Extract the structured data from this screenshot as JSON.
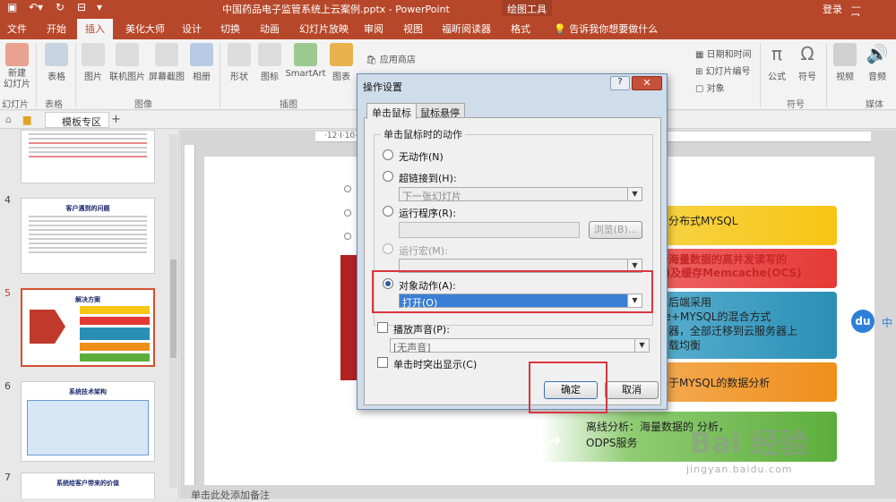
{
  "titlebar": {
    "title": "中国药品电子监管系统上云案例.pptx  -  PowerPoint",
    "context_tab": "绘图工具",
    "login": "登录",
    "window_controls": "— ❐ ✕"
  },
  "tabs": [
    "文件",
    "开始",
    "插入",
    "美化大师",
    "设计",
    "切换",
    "动画",
    "幻灯片放映",
    "审阅",
    "视图",
    "福昕阅读器",
    "格式"
  ],
  "tell_me": "告诉我你想要做什么",
  "ribbon": {
    "new_slide": "新建\n幻灯片",
    "table": "表格",
    "picture": "图片",
    "online_picture": "联机图片",
    "screenshot": "屏幕截图",
    "album": "相册",
    "shapes": "形状",
    "icons": "图标",
    "smartart": "SmartArt",
    "chart": "图表",
    "app_store": "应用商店",
    "date_time": "日期和时间",
    "slide_number": "幻灯片编号",
    "object": "对象",
    "equation": "公式",
    "symbol": "符号",
    "video": "视频",
    "audio": "音频",
    "slide_group": "幻灯片",
    "table_group": "表格",
    "image_group": "图像",
    "illustration_group": "插图",
    "symbol_group": "符号",
    "media_group": "媒体"
  },
  "thumbbar": {
    "template_tab": "模板专区",
    "add": "+"
  },
  "slides": [
    {
      "num": "4",
      "title": "客户遇到的问题"
    },
    {
      "num": "5",
      "title": "解决方案"
    },
    {
      "num": "6",
      "title": "系统技术架构"
    },
    {
      "num": "7",
      "title": "系统给客户带来的价值"
    }
  ],
  "slide_content": {
    "bars": [
      {
        "text": "的分布式MYSQL",
        "color": "#f7c514"
      },
      {
        "text": "持海量数据的高并发读写的\nS)及缓存Memcache(OCS)",
        "color": "#e53935"
      },
      {
        "text": "用后端采用\nhe+MYSQL的混合方式\n务器，全部迁移到云服务器上\n负载均衡",
        "color": "#2a8fb5"
      },
      {
        "text": "基于MYSQL的数据分析",
        "color": "#ef8f1a"
      },
      {
        "text": "离线分析：海量数据的   分析，\nODPS服务",
        "color": "#5cae3c"
      }
    ],
    "notes": "单击此处添加备注",
    "du_badge": "du",
    "du_text": "中",
    "watermark": "Bai 经验",
    "watermark_url": "jingyan.baidu.com"
  },
  "ruler_text": "·12·I·10·I·8·I·6·I·4·I·2·I·0·I·2·I·4·I·6·I·8·I·10·I·12·I·14·I·16·",
  "dialog": {
    "title": "操作设置",
    "help": "?",
    "close": "✕",
    "tab_click": "单击鼠标",
    "tab_hover": "鼠标悬停",
    "group_label": "单击鼠标时的动作",
    "none": "无动作(N)",
    "hyperlink": "超链接到(H):",
    "hyperlink_value": "下一张幻灯片",
    "run_program": "运行程序(R):",
    "browse": "浏览(B)...",
    "run_macro": "运行宏(M):",
    "object_action": "对象动作(A):",
    "object_action_value": "打开(O)",
    "play_sound": "播放声音(P):",
    "sound_value": "[无声音]",
    "highlight": "单击时突出显示(C)",
    "ok": "确定",
    "cancel": "取消"
  }
}
